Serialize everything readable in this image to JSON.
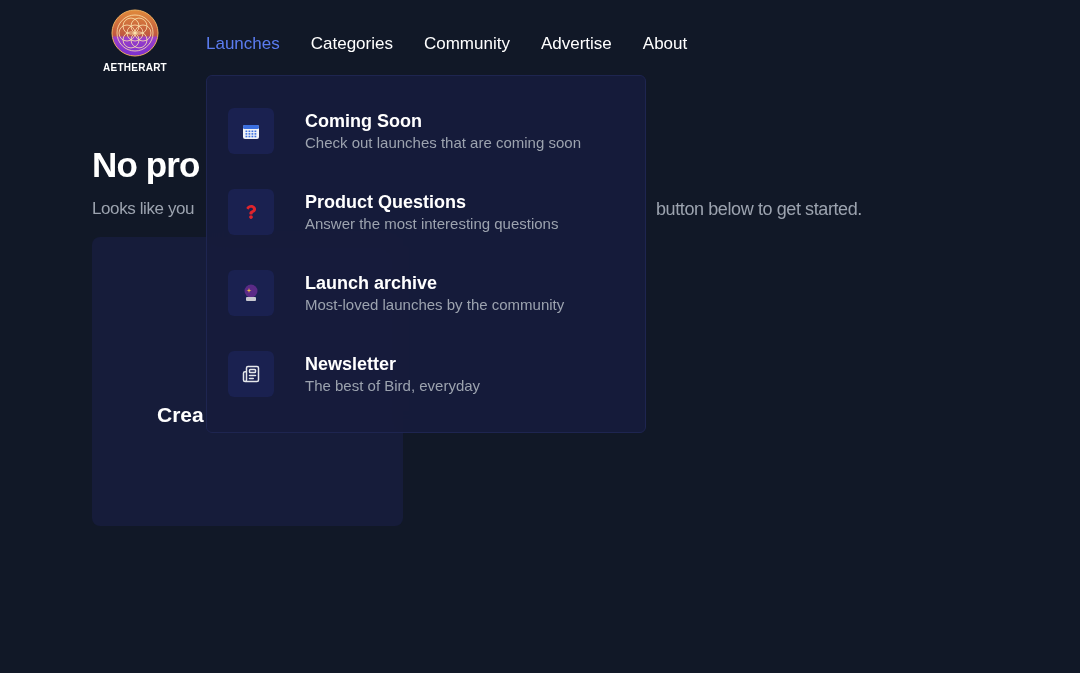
{
  "logo": {
    "text": "AETHERART"
  },
  "nav": [
    {
      "label": "Launches",
      "selected": true
    },
    {
      "label": "Categories",
      "selected": false
    },
    {
      "label": "Community",
      "selected": false
    },
    {
      "label": "Advertise",
      "selected": false
    },
    {
      "label": "About",
      "selected": false
    }
  ],
  "dropdown": [
    {
      "title": "Coming Soon",
      "description": "Check out launches that are coming soon"
    },
    {
      "title": "Product Questions",
      "description": "Answer the most interesting questions"
    },
    {
      "title": "Launch archive",
      "description": "Most-loved launches by the community"
    },
    {
      "title": "Newsletter",
      "description": "The best of Bird, everyday"
    }
  ],
  "empty_state": {
    "heading": "No pro",
    "subtitle_start": "Looks like you",
    "subtitle_end": "button below to get started.",
    "card_label": "Crea"
  }
}
